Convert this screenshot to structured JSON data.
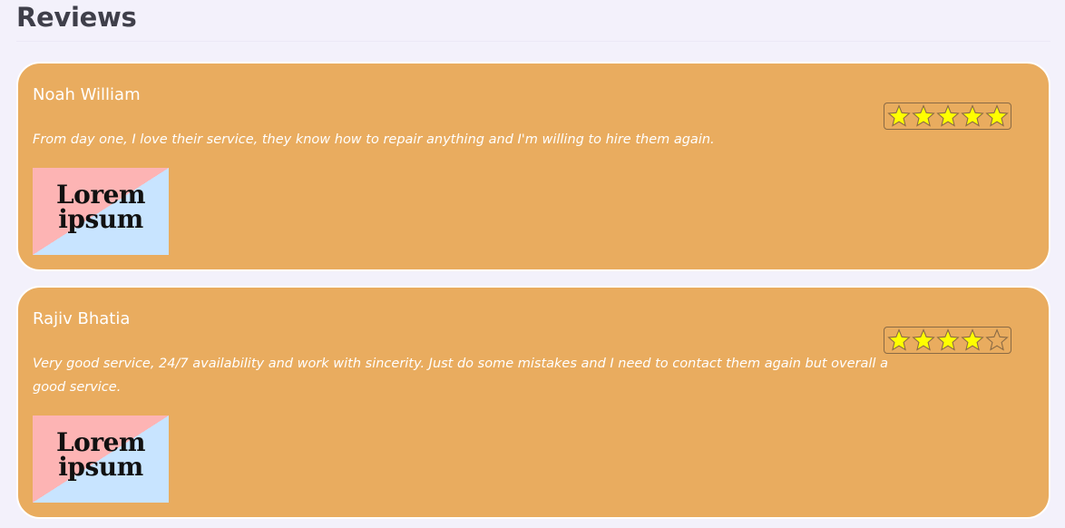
{
  "page": {
    "title": "Reviews"
  },
  "reviews": [
    {
      "name": "Noah William",
      "text": "From day one, I love their service, they know how to repair anything and I'm willing to hire them again.",
      "image_text": [
        "Lorem",
        "ipsum"
      ],
      "rating": 5,
      "rating_max": 5
    },
    {
      "name": "Rajiv Bhatia",
      "text": "Very good service, 24/7 availability and work with sincerity. Just do some mistakes and I need to contact them again but overall a good service.",
      "image_text": [
        "Lorem",
        "ipsum"
      ],
      "rating": 4,
      "rating_max": 5
    }
  ],
  "colors": {
    "page_background": "#f3f1fb",
    "card_background": "#e9ac5f",
    "star_filled": "#ffff00",
    "star_outline": "#8a6a45"
  },
  "icons": {
    "star": "star-icon"
  }
}
